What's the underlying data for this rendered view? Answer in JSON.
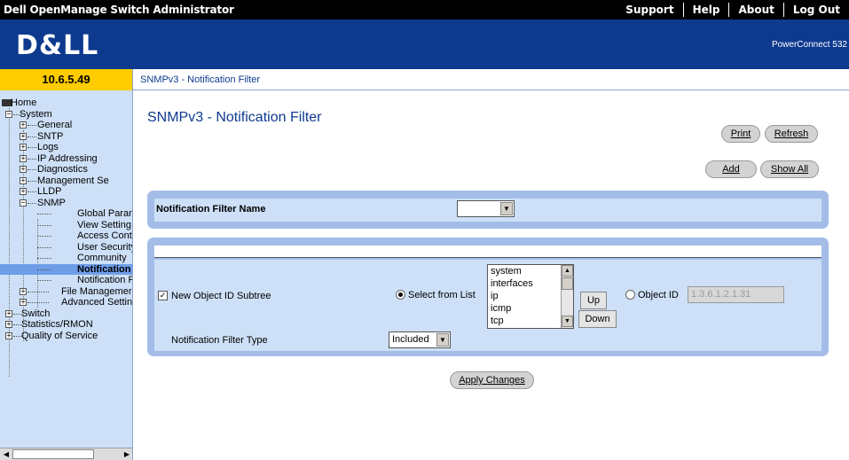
{
  "app": {
    "title": "Dell OpenManage Switch Administrator",
    "nav": [
      "Support",
      "Help",
      "About",
      "Log Out"
    ],
    "logo": "D&LL",
    "model": "PowerConnect 532"
  },
  "ip_address": "10.6.5.49",
  "breadcrumb": "SNMPv3 - Notification Filter",
  "tree": {
    "home": "Home",
    "system": "System",
    "general": "General",
    "sntp": "SNTP",
    "logs": "Logs",
    "ip_addressing": "IP Addressing",
    "diagnostics": "Diagnostics",
    "management_security": "Management Se",
    "lldp": "LLDP",
    "snmp": "SNMP",
    "global_parameters": "Global Paran",
    "view_settings": "View Setting",
    "access_control": "Access Cont",
    "user_security": "User Security",
    "communities": "Community",
    "notification_filter": "Notification",
    "notification_recipients": "Notification F",
    "file_management": "File Managemer",
    "advanced_settings": "Advanced Settin",
    "switch": "Switch",
    "statistics_rmon": "Statistics/RMON",
    "quality_of_service": "Quality of Service"
  },
  "page": {
    "title": "SNMPv3 - Notification Filter",
    "buttons": {
      "print": "Print",
      "refresh": "Refresh",
      "add": "Add",
      "show_all": "Show All",
      "apply": "Apply Changes"
    }
  },
  "form": {
    "filter_name_label": "Notification Filter Name",
    "filter_name_value": "",
    "new_oid_label": "New Object ID Subtree",
    "new_oid_checked": true,
    "select_from_list_label": "Select from List",
    "select_from_list_selected": true,
    "oid_list": [
      "system",
      "interfaces",
      "ip",
      "icmp",
      "tcp"
    ],
    "up_label": "Up",
    "down_label": "Down",
    "object_id_label": "Object ID",
    "object_id_selected": false,
    "object_id_value": "1.3.6.1.2.1.31",
    "filter_type_label": "Notification Filter Type",
    "filter_type_value": "Included"
  },
  "colors": {
    "header_blue": "#0d3a8f",
    "ip_yellow": "#ffcc00",
    "sidebar_bg": "#cde0f7",
    "panel_blue": "#a4bde8",
    "selected_node": "#6f9ee8"
  }
}
